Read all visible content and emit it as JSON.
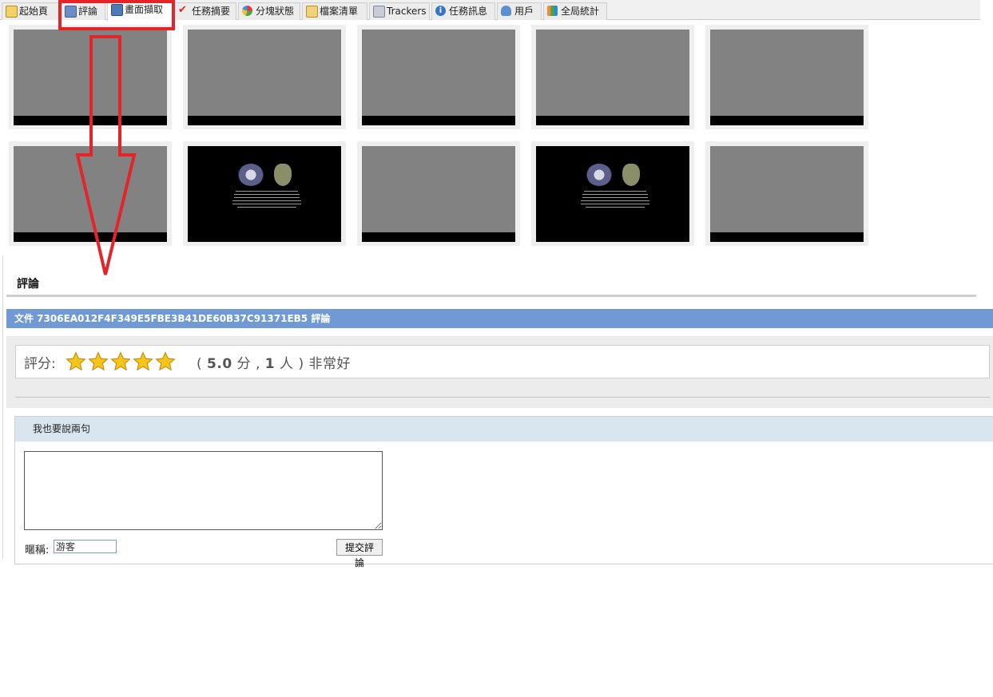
{
  "tabs": [
    {
      "label": "起始頁"
    },
    {
      "label": "評論"
    },
    {
      "label": "畫面擷取"
    },
    {
      "label": "任務摘要"
    },
    {
      "label": "分塊狀態"
    },
    {
      "label": "檔案清單"
    },
    {
      "label": "Trackers"
    },
    {
      "label": "任務訊息"
    },
    {
      "label": "用戶"
    },
    {
      "label": "全局統計"
    }
  ],
  "comments": {
    "section_title": "評論",
    "header": "文件 7306EA012F4F349E5FBE3B41DE60B37C91371EB5 評論",
    "rating_label": "評分:",
    "rating_value": 5.0,
    "rating_summary_open": "( ",
    "rating_score": "5.0",
    "rating_mid": " 分 , ",
    "rating_people": "1",
    "rating_close": " 人 ) 非常好",
    "post_header": "我也要說兩句",
    "nickname_label": "暱稱:",
    "nickname_value": "游客",
    "submit_label": "提交評論"
  },
  "colors": {
    "header_blue": "#6f9ad4",
    "annotation_red": "#e3252a",
    "star": "#f5c518"
  }
}
